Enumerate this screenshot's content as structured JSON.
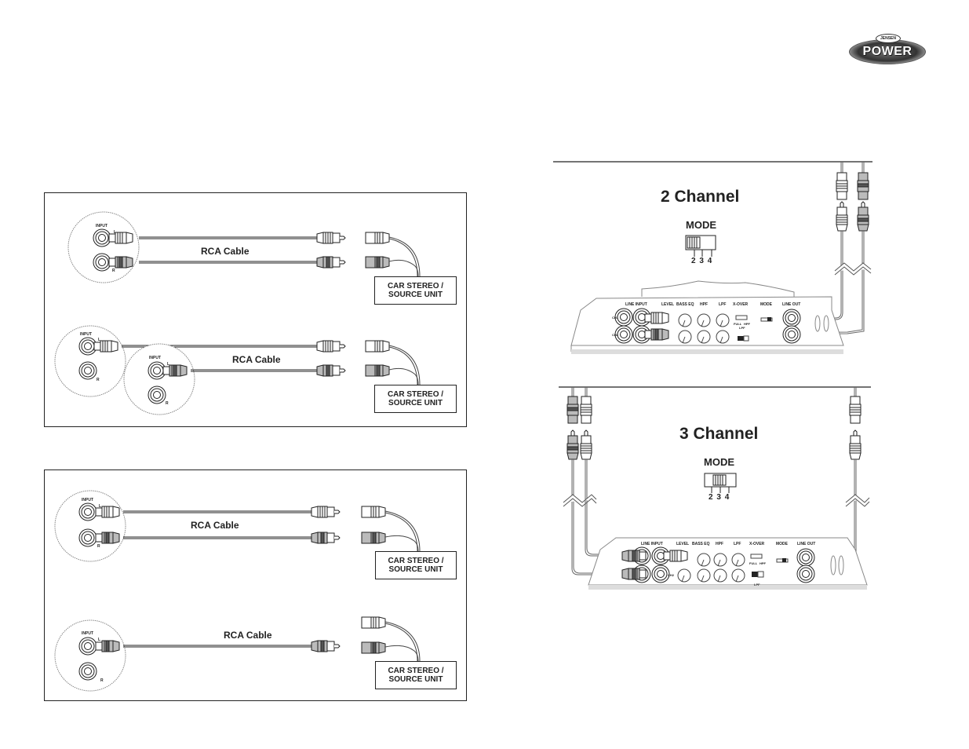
{
  "logo": {
    "brand": "JENSEN",
    "product": "POWER"
  },
  "left_diagrams": {
    "top_panel": {
      "scenarios": [
        {
          "cable_label": "RCA Cable",
          "input_label": "INPUT",
          "left_label": "L",
          "right_label": "R",
          "unit_label_line1": "CAR STEREO /",
          "unit_label_line2": "SOURCE UNIT"
        },
        {
          "cable_label": "RCA Cable",
          "input_label": "INPUT",
          "left_label": "L",
          "right_label": "R",
          "unit_label_line1": "CAR STEREO /",
          "unit_label_line2": "SOURCE UNIT"
        }
      ]
    },
    "bottom_panel": {
      "scenarios": [
        {
          "cable_label": "RCA Cable",
          "input_label": "INPUT",
          "left_label": "L",
          "right_label": "R",
          "unit_label_line1": "CAR STEREO /",
          "unit_label_line2": "SOURCE UNIT"
        },
        {
          "cable_label": "RCA Cable",
          "input_label": "INPUT",
          "left_label": "L",
          "right_label": "R",
          "unit_label_line1": "CAR STEREO /",
          "unit_label_line2": "SOURCE UNIT"
        }
      ]
    }
  },
  "right_diagrams": {
    "two_channel": {
      "title": "2 Channel",
      "mode_label": "MODE",
      "switch_positions": [
        "2",
        "3",
        "4"
      ],
      "selected_position": "2",
      "amp_labels": [
        "LINE INPUT",
        "LEVEL",
        "BASS EQ",
        "HPF",
        "LPF",
        "X-OVER",
        "MODE",
        "LINE OUT"
      ],
      "channel_labels": [
        "CH1",
        "CH2"
      ],
      "xover_labels": [
        "FULL",
        "HPF",
        "LPF"
      ]
    },
    "three_channel": {
      "title": "3 Channel",
      "mode_label": "MODE",
      "switch_positions": [
        "2",
        "3",
        "4"
      ],
      "selected_position": "3",
      "amp_labels": [
        "LINE INPUT",
        "LEVEL",
        "BASS EQ",
        "HPF",
        "LPF",
        "X-OVER",
        "MODE",
        "LINE OUT"
      ],
      "channel_labels": [
        "CH1",
        "CH2"
      ],
      "xover_labels": [
        "FULL",
        "HPF",
        "LPF"
      ]
    }
  }
}
